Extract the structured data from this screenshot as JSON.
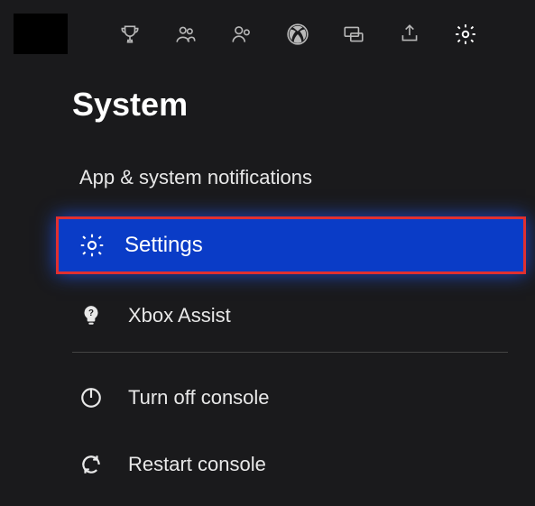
{
  "title": "System",
  "notifications_label": "App & system notifications",
  "settings_label": "Settings",
  "assist_label": "Xbox Assist",
  "turnoff_label": "Turn off console",
  "restart_label": "Restart console"
}
